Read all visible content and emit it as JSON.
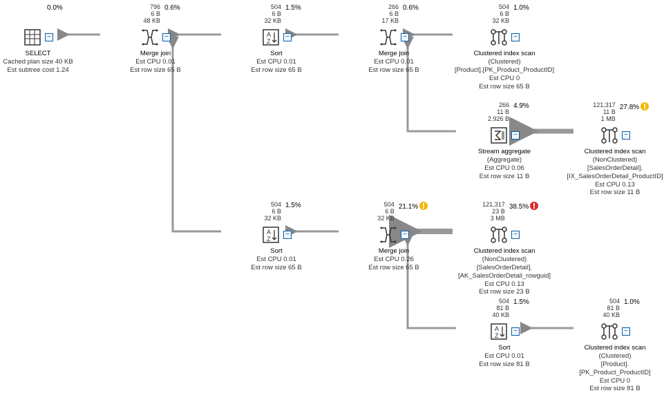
{
  "nodes": {
    "select": {
      "cost_pct": "0.0%",
      "stats": [
        "796",
        "6 B",
        "48 KB"
      ],
      "title": "SELECT",
      "lines": [
        "Cached plan size  40 KB",
        "Est subtree cost  1.24"
      ]
    },
    "merge1": {
      "cost_pct": "0.6%",
      "stats": [
        "504",
        "6 B",
        "32 KB"
      ],
      "title": "Merge join",
      "lines": [
        "Est CPU  0.01",
        "Est row size  65 B"
      ]
    },
    "sort1": {
      "cost_pct": "1.5%",
      "stats": [
        "266",
        "6 B",
        "17 KB"
      ],
      "title": "Sort",
      "lines": [
        "Est CPU  0.01",
        "Est row size  65 B"
      ]
    },
    "merge2": {
      "cost_pct": "0.6%",
      "stats": [
        "504",
        "6 B",
        "32 KB"
      ],
      "title": "Merge join",
      "lines": [
        "Est CPU  0.01",
        "Est row size  65 B"
      ]
    },
    "cix_product1": {
      "cost_pct": "1.0%",
      "stats": [
        "266",
        "11 B",
        "2.926 B"
      ],
      "title": "Clustered index scan",
      "lines": [
        "(Clustered)",
        "[Product].[PK_Product_ProductID]",
        "Est CPU  0",
        "Est row size  65 B"
      ]
    },
    "stream_agg": {
      "cost_pct": "4.9%",
      "stats": [
        "121,317",
        "11 B",
        "1 MB"
      ],
      "title": "Stream aggregate",
      "lines": [
        "(Aggregate)",
        "Est CPU  0.06",
        "Est row size  11 B"
      ]
    },
    "cix_sod_noncl1": {
      "cost_pct": "27.8%",
      "warn": "yellow",
      "stats": [],
      "title": "Clustered index scan",
      "lines": [
        "(NonClustered)",
        "[SalesOrderDetail].",
        "[IX_SalesOrderDetail_ProductID]",
        "Est CPU  0.13",
        "Est row size  11 B"
      ]
    },
    "sort2": {
      "cost_pct": "1.5%",
      "stats": [
        "504",
        "6 B",
        "32 KB"
      ],
      "title": "Sort",
      "lines": [
        "Est CPU  0.01",
        "Est row size  65 B"
      ]
    },
    "merge3": {
      "cost_pct": "21.1%",
      "warn": "yellow",
      "stats": [
        "121,317",
        "23 B",
        "3 MB"
      ],
      "title": "Merge join",
      "lines": [
        "Est CPU  0.26",
        "Est row size  65 B"
      ]
    },
    "cix_sod_noncl2": {
      "cost_pct": "38.5%",
      "warn": "red",
      "stats": [],
      "title": "Clustered index scan",
      "lines": [
        "(NonClustered)",
        "[SalesOrderDetail].",
        "[AK_SalesOrderDetail_rowguid]",
        "Est CPU  0.13",
        "Est row size  23 B"
      ]
    },
    "sort3": {
      "cost_pct": "1.5%",
      "stats": [
        "504",
        "81 B",
        "40 KB"
      ],
      "title": "Sort",
      "lines": [
        "Est CPU  0.01",
        "Est row size  81 B"
      ]
    },
    "cix_product2": {
      "cost_pct": "1.0%",
      "stats": [],
      "title": "Clustered index scan",
      "lines": [
        "(Clustered)",
        "[Product].[PK_Product_ProductID]",
        "Est CPU  0",
        "Est row size  81 B"
      ]
    },
    "sort2_prestats": [
      "504",
      "6 B",
      "32 KB"
    ],
    "sort3_prestats": [
      "504",
      "81 B",
      "40 KB"
    ]
  },
  "toggle_label": "−"
}
